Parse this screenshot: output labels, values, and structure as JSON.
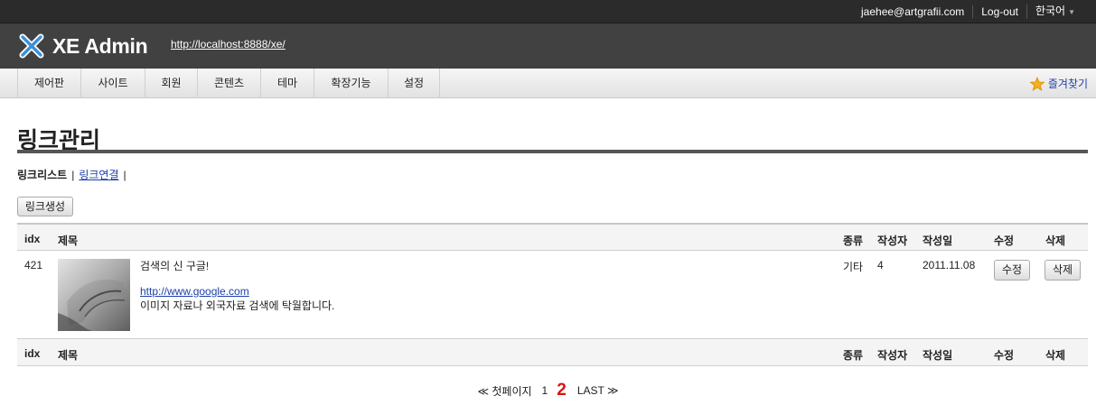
{
  "account": {
    "email": "jaehee@artgrafii.com",
    "logout": "Log-out",
    "language": "한국어"
  },
  "header": {
    "app_title": "XE Admin",
    "site_url": "http://localhost:8888/xe/"
  },
  "gnb": {
    "items": [
      {
        "label": "제어판"
      },
      {
        "label": "사이트"
      },
      {
        "label": "회원"
      },
      {
        "label": "콘텐츠"
      },
      {
        "label": "테마"
      },
      {
        "label": "확장기능"
      },
      {
        "label": "설정"
      }
    ],
    "favorites": "즐겨찾기"
  },
  "page": {
    "title": "링크관리",
    "subnav": {
      "current": "링크리스트",
      "link": "링크연결"
    },
    "create_button": "링크생성"
  },
  "table": {
    "headers": {
      "idx": "idx",
      "title": "제목",
      "type": "종류",
      "author": "작성자",
      "date": "작성일",
      "edit": "수정",
      "delete": "삭제"
    },
    "rows": [
      {
        "idx": "421",
        "title": "검색의 신 구글!",
        "url": "http://www.google.com",
        "description": "이미지 자료나 외국자료 검색에 탁월합니다.",
        "type": "기타",
        "author": "4",
        "date": "2011.11.08",
        "edit_label": "수정",
        "delete_label": "삭제"
      }
    ]
  },
  "pagination": {
    "first": "≪ 첫페이지",
    "pages": [
      "1",
      "2"
    ],
    "current": "2",
    "last": "LAST ≫"
  },
  "colors": {
    "topbar": "#2b2b2b",
    "header": "#414141",
    "link": "#1d3fa8",
    "current_page": "#dd1111"
  }
}
